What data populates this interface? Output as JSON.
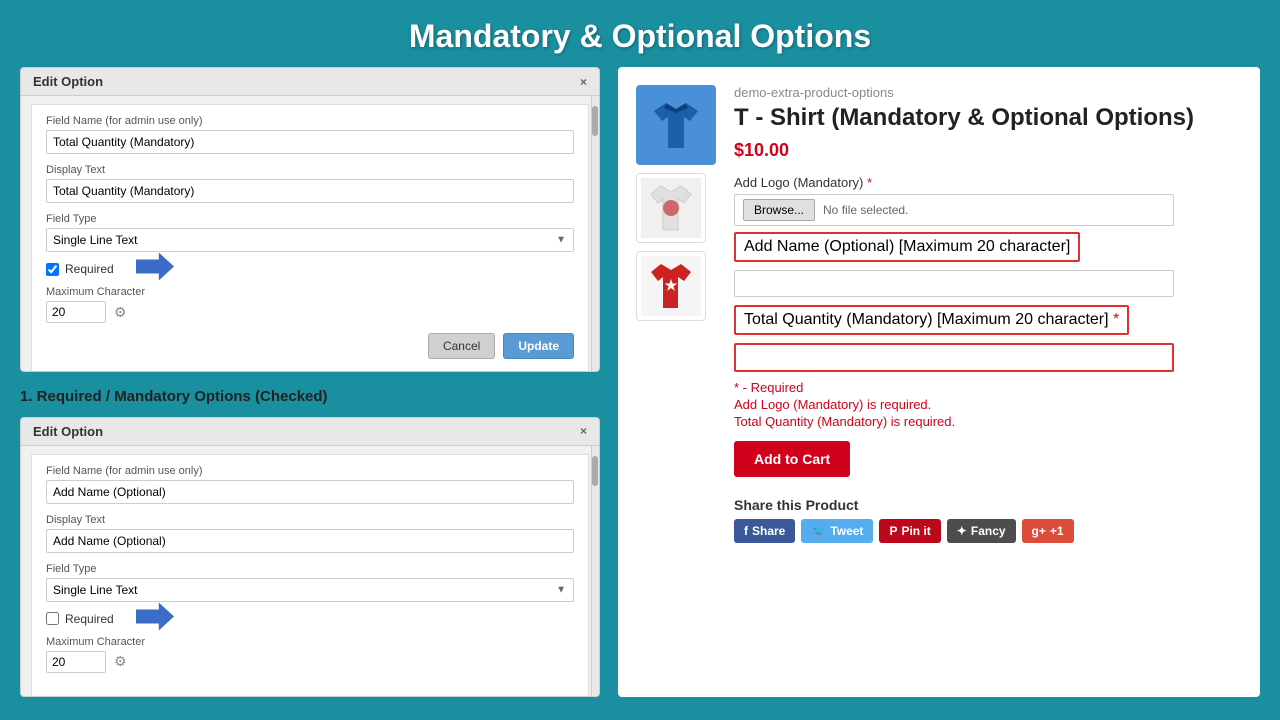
{
  "page": {
    "title": "Mandatory & Optional Options",
    "background_color": "#1a8fa0"
  },
  "left_panel": {
    "box1": {
      "title": "Edit Option",
      "close_label": "×",
      "field_name_label": "Field Name (for admin use only)",
      "field_name_value": "Total Quantity (Mandatory)",
      "display_text_label": "Display Text",
      "display_text_value": "Total Quantity (Mandatory)",
      "field_type_label": "Field Type",
      "field_type_value": "Single Line Text",
      "required_label": "Required",
      "required_checked": true,
      "max_char_label": "Maximum Character",
      "max_char_value": "20",
      "cancel_label": "Cancel",
      "update_label": "Update"
    },
    "label1": "1. Required / Mandatory Options (Checked)",
    "box2": {
      "title": "Edit Option",
      "close_label": "×",
      "field_name_label": "Field Name (for admin use only)",
      "field_name_value": "Add Name (Optional)",
      "display_text_label": "Display Text",
      "display_text_value": "Add Name (Optional)",
      "field_type_label": "Field Type",
      "field_type_value": "Single Line Text",
      "required_label": "Required",
      "required_checked": false,
      "max_char_label": "Maximum Character",
      "max_char_value": "20"
    }
  },
  "right_panel": {
    "store_name": "demo-extra-product-options",
    "product_title": "T - Shirt (Mandatory & Optional Options)",
    "product_price": "$10.00",
    "field1_label": "Add Logo (Mandatory)",
    "field1_required": true,
    "browse_btn_label": "Browse...",
    "no_file_text": "No file selected.",
    "field2_label": "Add Name (Optional) [Maximum 20 character]",
    "field2_required": false,
    "field3_label": "Total Quantity (Mandatory) [Maximum 20 character]",
    "field3_required": true,
    "required_note": "* - Required",
    "error1": "Add Logo (Mandatory) is required.",
    "error2": "Total Quantity (Mandatory) is required.",
    "add_to_cart_label": "Add to Cart",
    "share_title": "Share this Product",
    "share_fb": "Share",
    "share_tw": "Tweet",
    "share_pin": "Pin it",
    "share_fancy": "Fancy",
    "share_gplus": "+1"
  }
}
